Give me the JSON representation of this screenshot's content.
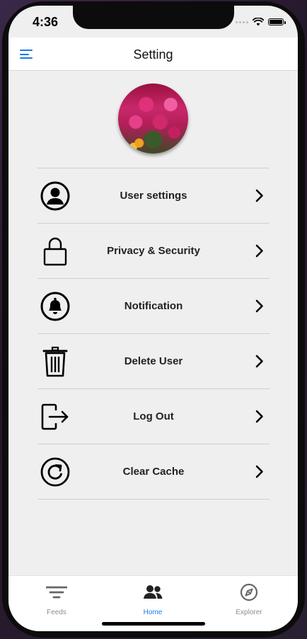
{
  "status_bar": {
    "time": "4:36"
  },
  "nav": {
    "title": "Setting",
    "menu_icon": "hamburger-menu-icon"
  },
  "settings": [
    {
      "label": "User settings",
      "icon": "user-circle-icon"
    },
    {
      "label": "Privacy & Security",
      "icon": "lock-icon"
    },
    {
      "label": "Notification",
      "icon": "bell-icon"
    },
    {
      "label": "Delete User",
      "icon": "trash-icon"
    },
    {
      "label": "Log Out",
      "icon": "logout-icon"
    },
    {
      "label": "Clear Cache",
      "icon": "refresh-icon"
    }
  ],
  "tabs": [
    {
      "label": "Feeds",
      "icon": "filter-icon",
      "active": false
    },
    {
      "label": "Home",
      "icon": "users-icon",
      "active": true
    },
    {
      "label": "Explorer",
      "icon": "compass-icon",
      "active": false
    }
  ],
  "colors": {
    "accent": "#1f7ae0",
    "inactive": "#8e8e93",
    "background": "#efefef"
  }
}
